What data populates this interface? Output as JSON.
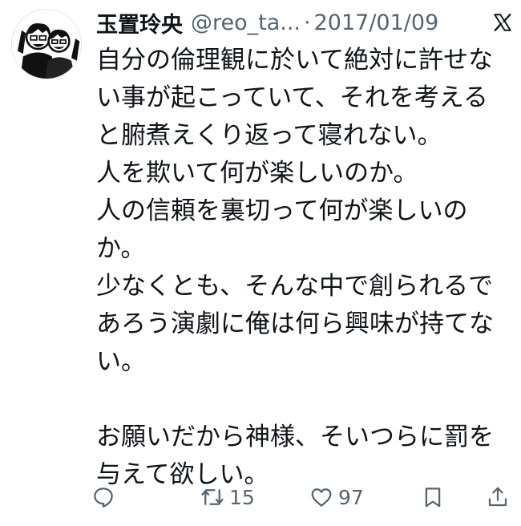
{
  "tweet": {
    "author_name": "玉置玲央",
    "handle": "@reo_ta...",
    "separator": "·",
    "date": "2017/01/09",
    "lines": [
      "自分の倫理観に於いて絶対に許せな",
      "い事が起こっていて、それを考える",
      "と腑煮えくり返って寝れない。",
      "人を欺いて何が楽しいのか。",
      "人の信頼を裏切って何が楽しいの",
      "か。",
      "少なくとも、そんな中で創られるで",
      "あろう演劇に俺は何ら興味が持てな",
      "い。",
      "",
      "お願いだから神様、そいつらに罰を",
      "与えて欲しい。"
    ]
  },
  "actions": {
    "reply_icon": "reply-icon",
    "retweet_icon": "retweet-icon",
    "retweet_count": "15",
    "like_icon": "heart-icon",
    "like_count": "97",
    "bookmark_icon": "bookmark-icon",
    "share_icon": "share-icon"
  },
  "colors": {
    "text": "#0f1419",
    "secondary": "#536471",
    "background": "#ffffff"
  }
}
